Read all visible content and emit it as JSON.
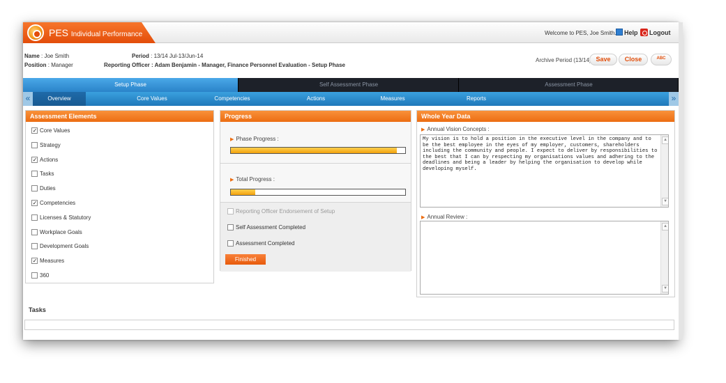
{
  "app": {
    "title_main": "PES",
    "title_sub": "Individual Performance",
    "welcome": "Welcome to PES, Joe Smith.",
    "help_label": "Help",
    "logout_label": "Logout"
  },
  "info": {
    "name_label": "Name",
    "name_value": ": Joe Smith",
    "position_label": "Position",
    "position_value": ": Manager",
    "period_label": "Period",
    "period_value": ": 13/14 Jul-13/Jun-14",
    "officer": "Reporting Officer : Adam Benjamin - Manager, Finance Personnel Evaluation - Setup Phase",
    "archive": "Archive Period (13/14)",
    "save_label": "Save",
    "close_label": "Close",
    "spell_label": "ABC"
  },
  "phases": [
    "Setup Phase",
    "Self Assessment Phase",
    "Assessment Phase"
  ],
  "tabs": [
    "Overview",
    "Core Values",
    "Competencies",
    "Actions",
    "Measures",
    "Reports"
  ],
  "nav": {
    "prev": "«",
    "next": "»"
  },
  "assessment": {
    "title": "Assessment Elements",
    "items": [
      {
        "label": "Core Values",
        "checked": true
      },
      {
        "label": "Strategy",
        "checked": false
      },
      {
        "label": "Actions",
        "checked": true
      },
      {
        "label": "Tasks",
        "checked": false
      },
      {
        "label": "Duties",
        "checked": false
      },
      {
        "label": "Competencies",
        "checked": true
      },
      {
        "label": "Licenses & Statutory",
        "checked": false
      },
      {
        "label": "Workplace Goals",
        "checked": false
      },
      {
        "label": "Development Goals",
        "checked": false
      },
      {
        "label": "Measures",
        "checked": true
      },
      {
        "label": "360",
        "checked": false
      }
    ]
  },
  "progress": {
    "title": "Progress",
    "phase_label": "Phase Progress :",
    "phase_fraction": 0.95,
    "total_label": "Total Progress :",
    "total_fraction": 0.14,
    "endorse_label": "Reporting Officer Endorsement of Setup",
    "self_label": "Self Assessment Completed",
    "assess_label": "Assessment Completed",
    "finished_label": "Finished"
  },
  "whole_year": {
    "title": "Whole Year Data",
    "vision_label": "Annual Vision Concepts :",
    "vision_text": "My vision is to hold a position in the executive level in the company and to be the best employee in the eyes of my employer, customers, shareholders including the community and people. I expect to deliver by responsibilities to the best that I can by respecting my organisations values and adhering to the deadlines and being a leader by helping the organisation to develop while developing myself.",
    "review_label": "Annual Review :",
    "review_text": ""
  },
  "tasks": {
    "title": "Tasks"
  },
  "colors": {
    "accent": "#ec6d12",
    "tab_blue": "#2a83c9",
    "phase_dark": "#1d2129"
  }
}
